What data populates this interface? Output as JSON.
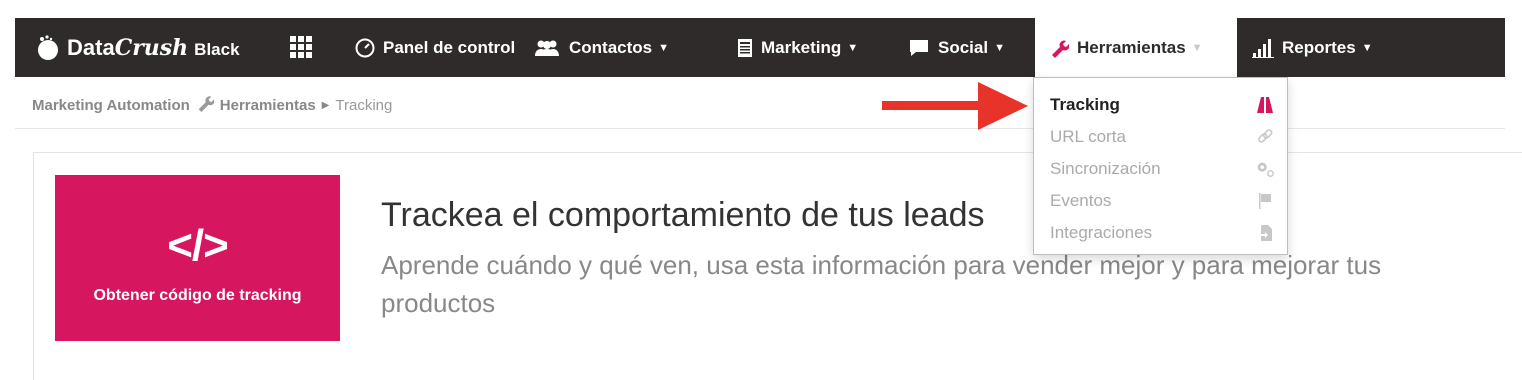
{
  "brand": {
    "data": "Data",
    "crush": "Crush",
    "black": "Black"
  },
  "nav": {
    "panel": "Panel de control",
    "contactos": "Contactos",
    "marketing": "Marketing",
    "social": "Social",
    "herramientas": "Herramientas",
    "reportes": "Reportes"
  },
  "breadcrumb": {
    "root": "Marketing Automation",
    "section": "Herramientas",
    "current": "Tracking"
  },
  "dropdown": {
    "items": [
      {
        "label": "Tracking",
        "icon": "road-icon",
        "selected": true
      },
      {
        "label": "URL corta",
        "icon": "link-icon",
        "selected": false
      },
      {
        "label": "Sincronización",
        "icon": "gears-icon",
        "selected": false
      },
      {
        "label": "Eventos",
        "icon": "flag-icon",
        "selected": false
      },
      {
        "label": "Integraciones",
        "icon": "file-import-icon",
        "selected": false
      }
    ]
  },
  "card": {
    "code": "</>",
    "label": "Obtener código de tracking"
  },
  "hero": {
    "title": "Trackea el comportamiento de tus leads",
    "subtitle": "Aprende cuándo y qué ven, usa esta información para vender mejor y para mejorar tus productos"
  },
  "colors": {
    "navbar": "#2f2b2b",
    "accent": "#d6175f",
    "arrow": "#e8332a"
  }
}
